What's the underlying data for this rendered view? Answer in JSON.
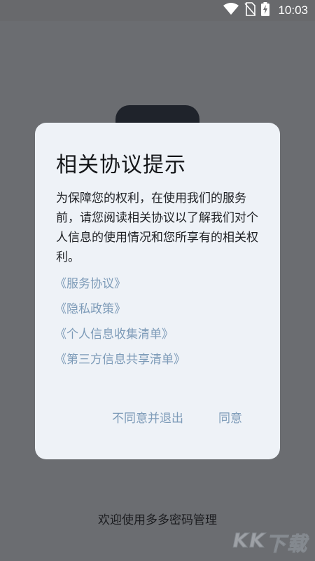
{
  "status_bar": {
    "time": "10:03",
    "icons": [
      "wifi-icon",
      "no-sim-icon",
      "battery-charging-icon"
    ]
  },
  "dialog": {
    "title": "相关协议提示",
    "body": "为保障您的权利，在使用我们的服务前，请您阅读相关协议以了解我们对个人信息的使用情况和您所享有的相关权利。",
    "links": [
      "《服务协议》",
      "《隐私政策》",
      "《个人信息收集清单》",
      "《第三方信息共享清单》"
    ],
    "decline_label": "不同意并退出",
    "agree_label": "同意"
  },
  "footer": {
    "welcome": "欢迎使用多多密码管理"
  },
  "watermark": {
    "text": "KK下载"
  },
  "colors": {
    "overlay": "#6b6d71",
    "dialog_bg": "#eef2f7",
    "link": "#7d9bb8",
    "title": "#15171a"
  }
}
